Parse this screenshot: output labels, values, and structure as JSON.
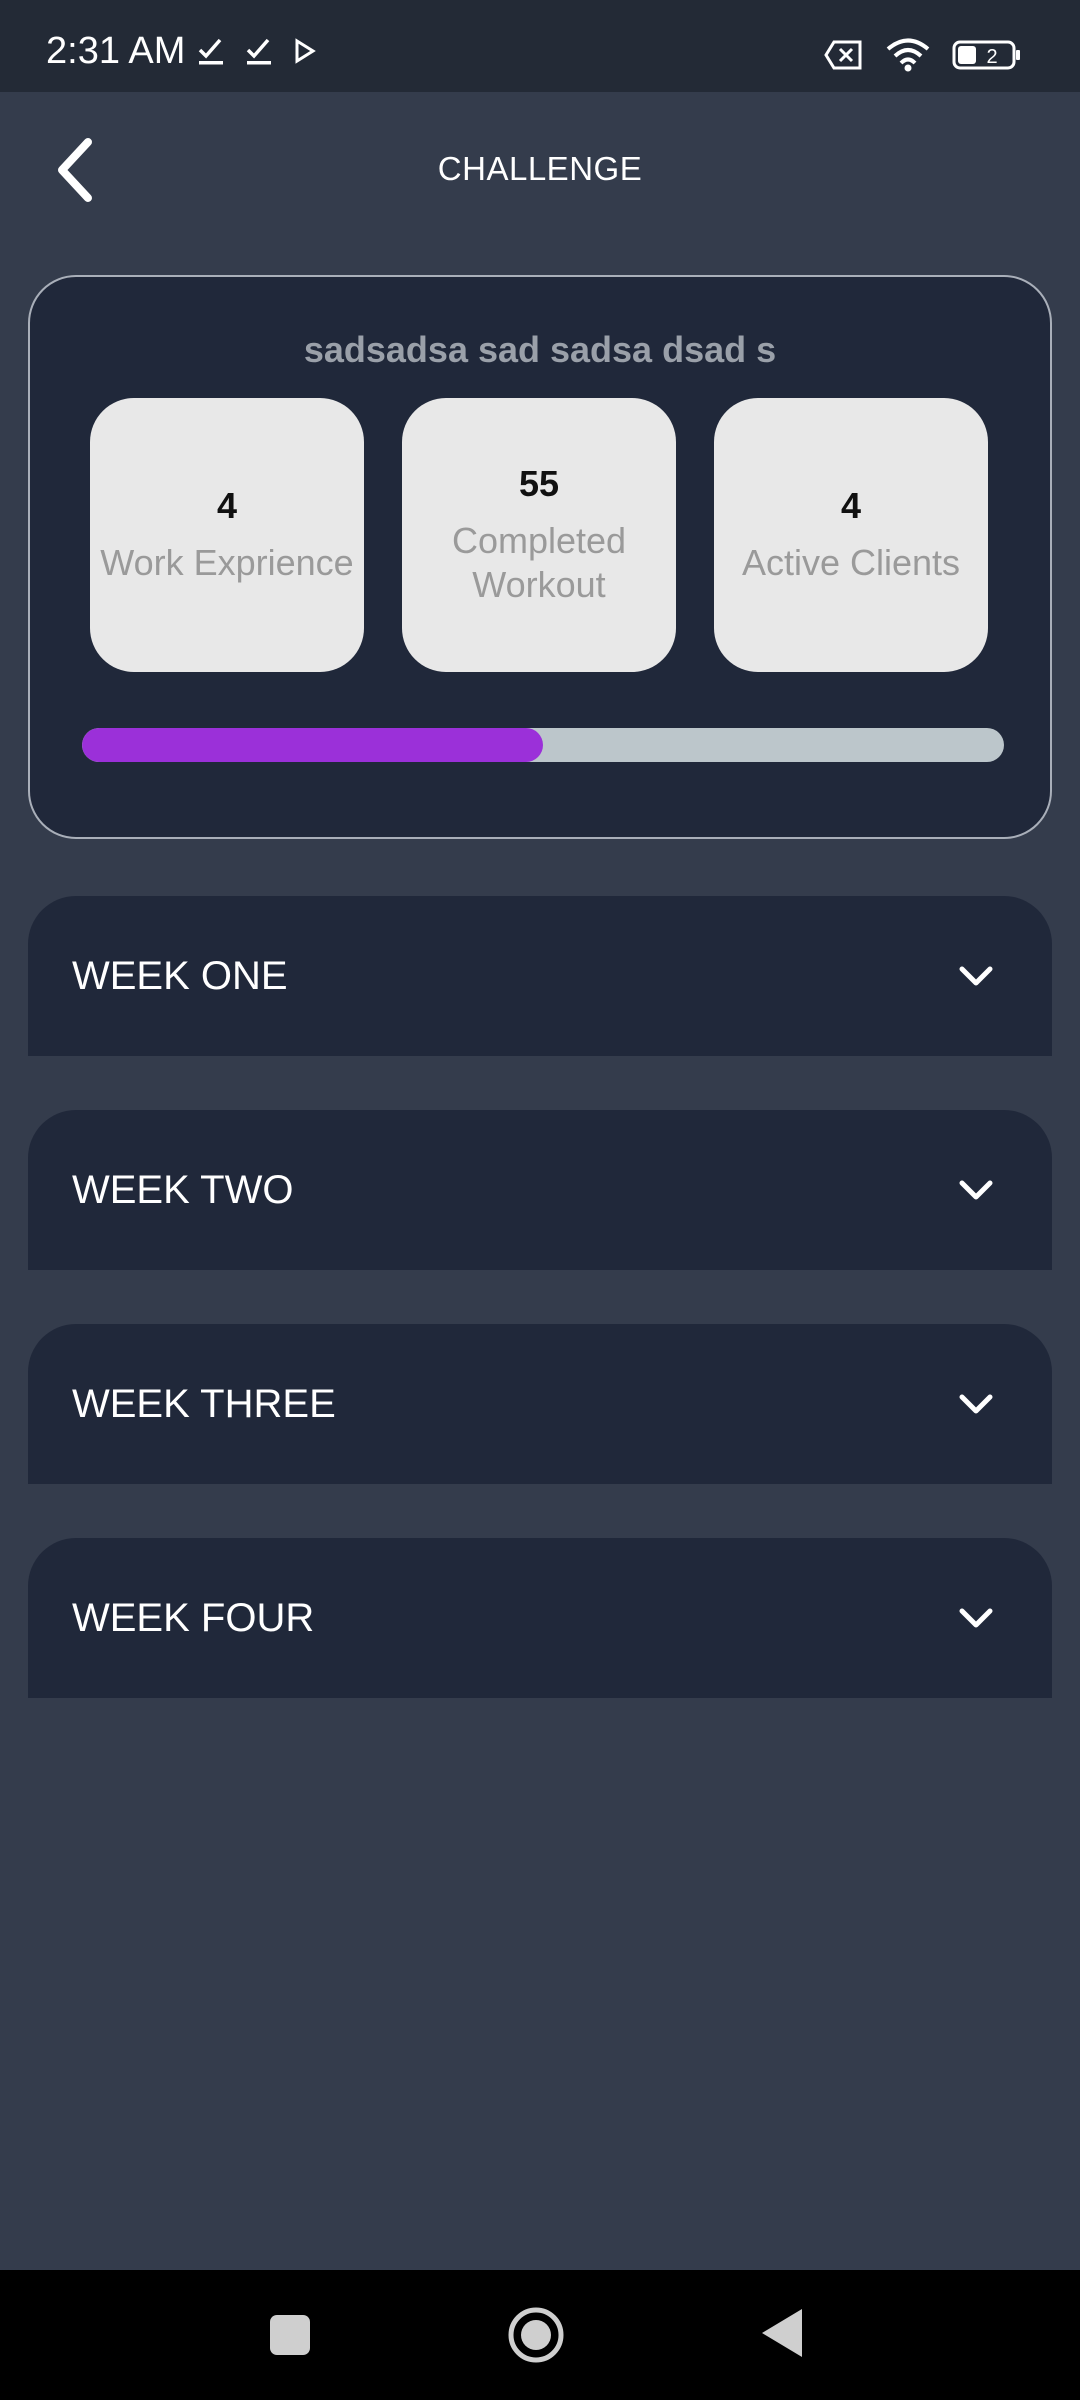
{
  "status_bar": {
    "time": "2:31 AM",
    "battery": "2"
  },
  "header": {
    "title": "CHALLENGE"
  },
  "card": {
    "title": "sadsadsa sad sadsa dsad s",
    "stats": [
      {
        "value": "4",
        "label": "Work Exprience"
      },
      {
        "value": "55",
        "label": "Completed Workout"
      },
      {
        "value": "4",
        "label": "Active Clients"
      }
    ],
    "progress_percent": 50
  },
  "weeks": [
    {
      "label": "WEEK ONE"
    },
    {
      "label": "WEEK TWO"
    },
    {
      "label": "WEEK THREE"
    },
    {
      "label": "WEEK FOUR"
    }
  ],
  "colors": {
    "background": "#343c4c",
    "card": "#20283a",
    "accent": "#9b30d9",
    "track": "#bcc6cb"
  }
}
